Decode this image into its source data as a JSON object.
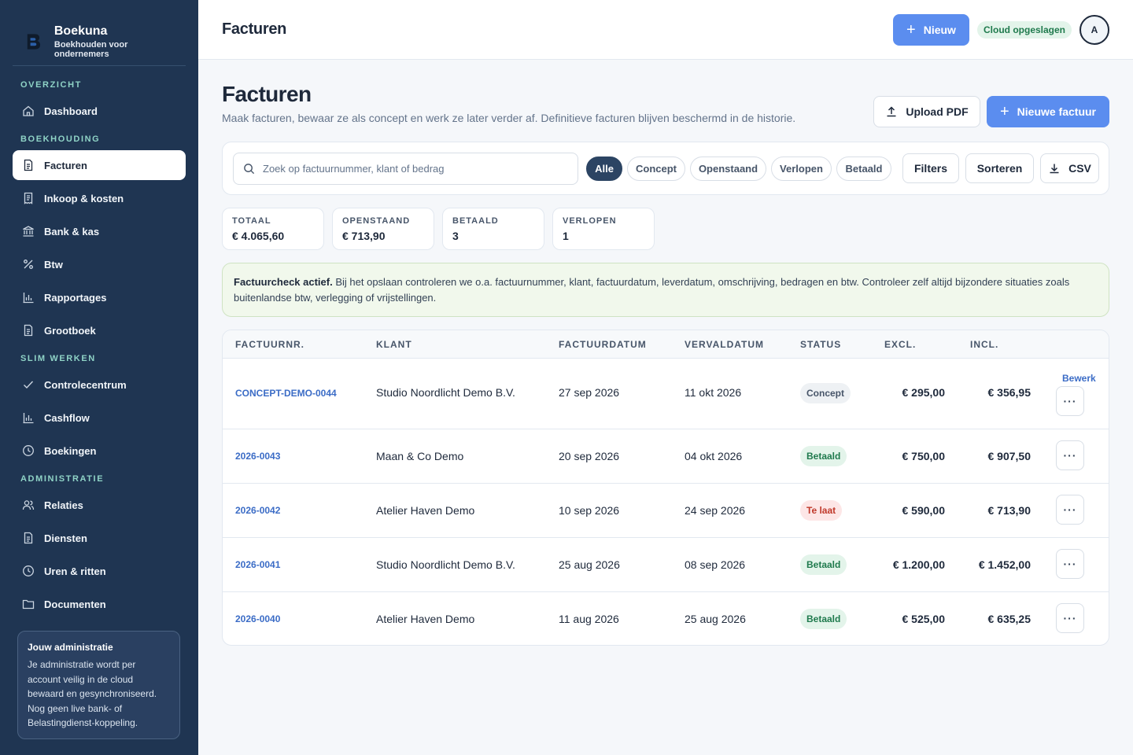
{
  "brand": {
    "name": "Boekuna",
    "tagline": "Boekhouden voor ondernemers"
  },
  "sidebar": {
    "sections": [
      {
        "title": "OVERZICHT",
        "items": [
          {
            "label": "Dashboard",
            "icon": "home-icon"
          }
        ]
      },
      {
        "title": "BOEKHOUDING",
        "items": [
          {
            "label": "Facturen",
            "icon": "document-icon",
            "active": true
          },
          {
            "label": "Inkoop & kosten",
            "icon": "receipt-icon"
          },
          {
            "label": "Bank & kas",
            "icon": "bank-icon"
          },
          {
            "label": "Btw",
            "icon": "percent-icon"
          },
          {
            "label": "Rapportages",
            "icon": "bar-chart-icon"
          },
          {
            "label": "Grootboek",
            "icon": "document-icon"
          }
        ]
      },
      {
        "title": "SLIM WERKEN",
        "items": [
          {
            "label": "Controlecentrum",
            "icon": "check-icon"
          },
          {
            "label": "Cashflow",
            "icon": "bar-chart-icon"
          },
          {
            "label": "Boekingen",
            "icon": "clock-icon"
          }
        ]
      },
      {
        "title": "ADMINISTRATIE",
        "items": [
          {
            "label": "Relaties",
            "icon": "users-icon"
          },
          {
            "label": "Diensten",
            "icon": "document-icon"
          },
          {
            "label": "Uren & ritten",
            "icon": "clock-icon"
          },
          {
            "label": "Documenten",
            "icon": "folder-icon"
          }
        ]
      }
    ],
    "info_card": {
      "title": "Jouw administratie",
      "text": "Je administratie wordt per account veilig in de cloud bewaard en gesynchroniseerd. Nog geen live bank- of Belastingdienst-koppeling."
    }
  },
  "topbar": {
    "title": "Facturen",
    "new_button": "Nieuw",
    "cloud_status": "Cloud opgeslagen",
    "avatar_initial": "A"
  },
  "page": {
    "title": "Facturen",
    "subtitle": "Maak facturen, bewaar ze als concept en werk ze later verder af. Definitieve facturen blijven beschermd in de historie.",
    "upload_button": "Upload PDF",
    "new_invoice_button": "Nieuwe factuur"
  },
  "toolbar": {
    "search_placeholder": "Zoek op factuurnummer, klant of bedrag",
    "search_value": "",
    "filters": [
      "Alle",
      "Concept",
      "Openstaand",
      "Verlopen",
      "Betaald"
    ],
    "active_filter": "Alle",
    "filters_button": "Filters",
    "sort_button": "Sorteren",
    "csv_button": "CSV"
  },
  "stats": [
    {
      "label": "TOTAAL",
      "value": "€ 4.065,60"
    },
    {
      "label": "OPENSTAAND",
      "value": "€ 713,90"
    },
    {
      "label": "BETAALD",
      "value": "3"
    },
    {
      "label": "VERLOPEN",
      "value": "1"
    }
  ],
  "notice": {
    "strong": "Factuurcheck actief.",
    "text": "Bij het opslaan controleren we o.a. factuurnummer, klant, factuurdatum, leverdatum, omschrijving, bedragen en btw. Controleer zelf altijd bijzondere situaties zoals buitenlandse btw, verlegging of vrijstellingen."
  },
  "table": {
    "columns": [
      "FACTUURNR.",
      "KLANT",
      "FACTUURDATUM",
      "VERVALDATUM",
      "STATUS",
      "EXCL.",
      "INCL."
    ],
    "edit_label": "Bewerk",
    "more_label": "···",
    "rows": [
      {
        "number": "CONCEPT-DEMO-0044",
        "client": "Studio Noordlicht Demo B.V.",
        "date": "27 sep 2026",
        "due": "11 okt 2026",
        "status": "Concept",
        "status_type": "concept",
        "excl": "€ 295,00",
        "incl": "€ 356,95",
        "editable": true
      },
      {
        "number": "2026-0043",
        "client": "Maan & Co Demo",
        "date": "20 sep 2026",
        "due": "04 okt 2026",
        "status": "Betaald",
        "status_type": "paid",
        "excl": "€ 750,00",
        "incl": "€ 907,50"
      },
      {
        "number": "2026-0042",
        "client": "Atelier Haven Demo",
        "date": "10 sep 2026",
        "due": "24 sep 2026",
        "status": "Te laat",
        "status_type": "late",
        "excl": "€ 590,00",
        "incl": "€ 713,90"
      },
      {
        "number": "2026-0041",
        "client": "Studio Noordlicht Demo B.V.",
        "date": "25 aug 2026",
        "due": "08 sep 2026",
        "status": "Betaald",
        "status_type": "paid",
        "excl": "€ 1.200,00",
        "incl": "€ 1.452,00"
      },
      {
        "number": "2026-0040",
        "client": "Atelier Haven Demo",
        "date": "11 aug 2026",
        "due": "25 aug 2026",
        "status": "Betaald",
        "status_type": "paid",
        "excl": "€ 525,00",
        "incl": "€ 635,25"
      }
    ]
  }
}
